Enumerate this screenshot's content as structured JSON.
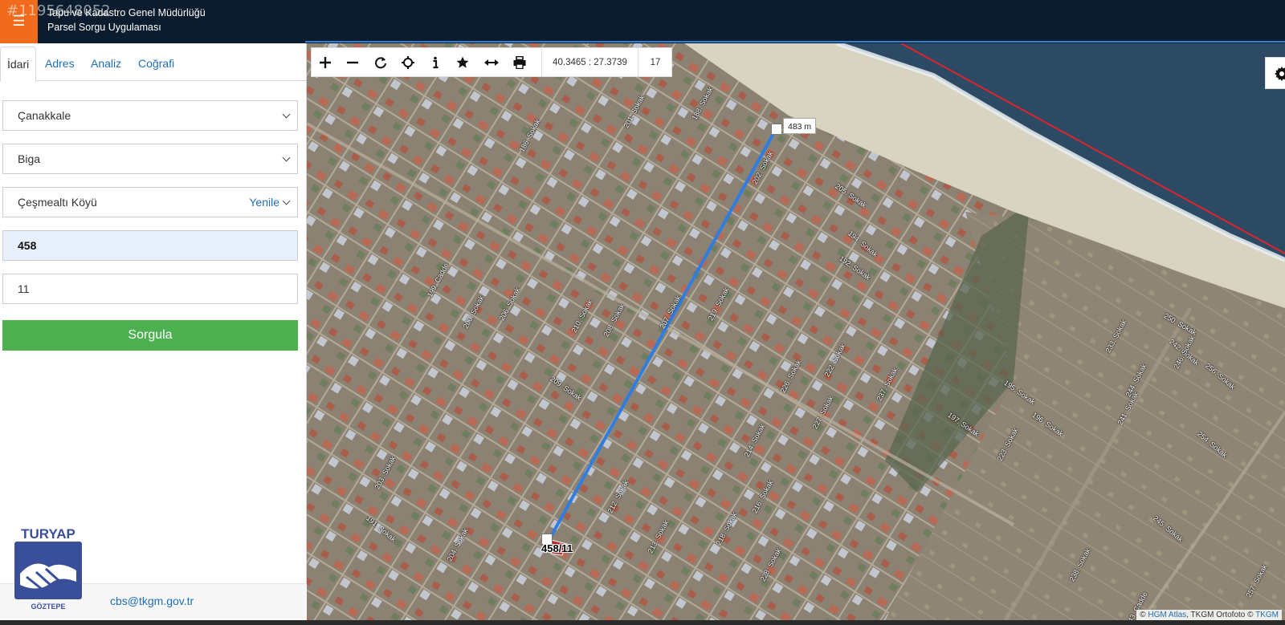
{
  "listing_id": "#1195648052",
  "header": {
    "title": "Tapu ve Kadastro Genel Müdürlüğü",
    "subtitle": "Parsel Sorgu Uygulaması"
  },
  "tabs": [
    {
      "label": "İdari",
      "active": true
    },
    {
      "label": "Adres",
      "active": false
    },
    {
      "label": "Analiz",
      "active": false
    },
    {
      "label": "Coğrafi",
      "active": false
    }
  ],
  "form": {
    "province": "Çanakkale",
    "district": "Biga",
    "neighborhood": "Çeşmealtı Köyü",
    "refresh_label": "Yenile",
    "ada": "458",
    "parsel": "11",
    "query_label": "Sorgula"
  },
  "contact_email": "cbs@tkgm.gov.tr",
  "logo": {
    "name": "TURYAP",
    "branch": "GÖZTEPE"
  },
  "map": {
    "coordinates": "40.3465 : 27.3739",
    "zoom_level": "17",
    "measure_distance": "483 m",
    "parcel_label": "458/11",
    "attribution_prefix": "©",
    "attribution_link1": "HGM Atlas",
    "attribution_mid": ", TKGM Ortofoto ©",
    "attribution_link2": "TKGM",
    "streets": [
      "188. Sokak",
      "201. Sokak",
      "202. Sokak",
      "205. Sokak",
      "186. Sokak",
      "192. Sokak",
      "194. Sokak",
      "195. Sokak",
      "196. Sokak",
      "197. Sokak",
      "199. Cadde",
      "200. Sokak",
      "207. Sokak",
      "208. Sokak",
      "212. Sokak",
      "213. Sokak",
      "218. Sokak",
      "219. Sokak",
      "222. Sokak",
      "223. Sokak",
      "233. Sokak",
      "241. Sokak",
      "242. Sokak",
      "244. Sokak",
      "245. Sokak",
      "246. Sokak",
      "250. Sokak",
      "254. Sokak",
      "256. Sokak",
      "257. Sokak",
      "238. Sokak",
      "243. Cadde",
      "191. Sokak",
      "203. Sokak",
      "204. Sokak",
      "206. Sokak",
      "209. Sokak",
      "210. Sokak",
      "214. Sokak",
      "216. Sokak",
      "226. Sokak",
      "227. Sokak",
      "228. Sokak",
      "237. Sokak"
    ],
    "icons": [
      "plus-icon",
      "minus-icon",
      "refresh-icon",
      "crosshair-icon",
      "info-icon",
      "star-icon",
      "measure-icon",
      "print-icon",
      "gear-icon"
    ]
  },
  "colors": {
    "header_bg": "#0b1c2f",
    "menu_accent": "#f06b1c",
    "link": "#1e6fb5",
    "query_button": "#4caf50",
    "measure_line": "#2f7de1",
    "coast_line": "#e0242c"
  }
}
